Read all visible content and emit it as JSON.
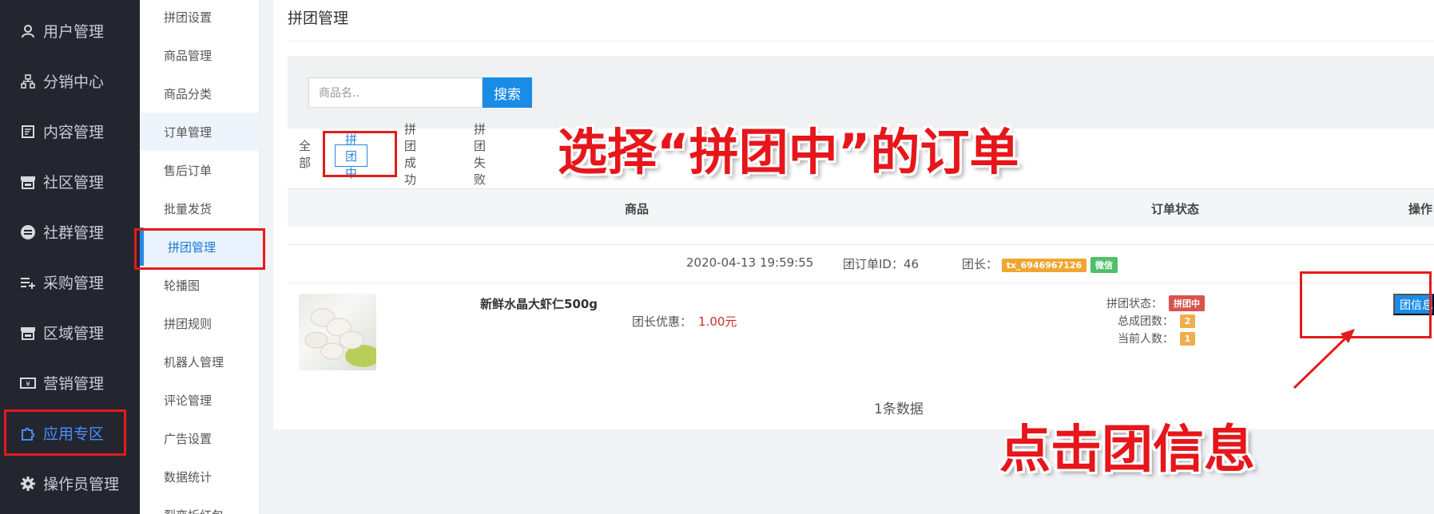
{
  "sidebar": {
    "items": [
      {
        "label": "用户管理",
        "icon": "user-icon"
      },
      {
        "label": "分销中心",
        "icon": "sitemap-icon"
      },
      {
        "label": "内容管理",
        "icon": "document-icon"
      },
      {
        "label": "社区管理",
        "icon": "store-icon"
      },
      {
        "label": "社群管理",
        "icon": "minus-circle-icon"
      },
      {
        "label": "采购管理",
        "icon": "list-add-icon"
      },
      {
        "label": "区域管理",
        "icon": "store-icon"
      },
      {
        "label": "营销管理",
        "icon": "ticket-icon"
      },
      {
        "label": "应用专区",
        "icon": "puzzle-icon",
        "active": true
      },
      {
        "label": "操作员管理",
        "icon": "gear-icon"
      }
    ]
  },
  "subnav": {
    "items": [
      {
        "label": "拼团设置"
      },
      {
        "label": "商品管理"
      },
      {
        "label": "商品分类"
      },
      {
        "label": "订单管理"
      },
      {
        "label": "售后订单"
      },
      {
        "label": "批量发货"
      },
      {
        "label": "拼团管理",
        "active": true
      },
      {
        "label": "轮播图"
      },
      {
        "label": "拼团规则"
      },
      {
        "label": "机器人管理"
      },
      {
        "label": "评论管理"
      },
      {
        "label": "广告设置"
      },
      {
        "label": "数据统计"
      },
      {
        "label": "裂变拆红包"
      }
    ]
  },
  "page": {
    "title": "拼团管理"
  },
  "search": {
    "placeholder": "商品名..",
    "button": "搜索"
  },
  "tabs": [
    {
      "label": "全部"
    },
    {
      "label": "拼团中",
      "active": true
    },
    {
      "label": "拼团成功"
    },
    {
      "label": "拼团失败"
    }
  ],
  "table": {
    "headers": {
      "product": "商品",
      "status": "订单状态",
      "action": "操作"
    }
  },
  "order": {
    "time": "2020-04-13 19:59:55",
    "group_id_label": "团订单ID：",
    "group_id": "46",
    "leader_label": "团长：",
    "leader_name": "tx_6946967126",
    "leader_channel": "微信",
    "product_name": "新鲜水晶大虾仁500g",
    "discount_label": "团长优惠：",
    "discount_value": "1.00元",
    "group_status_label": "拼团状态：",
    "group_status": "拼团中",
    "total_groups_label": "总成团数：",
    "total_groups": "2",
    "current_count_label": "当前人数：",
    "current_count": "1",
    "info_button": "团信息"
  },
  "footer": {
    "count_text": "1条数据"
  },
  "annotations": {
    "select_text": "选择“拼团中”的订单",
    "click_text": "点击团信息"
  },
  "colors": {
    "sidebar_bg": "#23262e",
    "accent": "#1a8ce6",
    "annotation_red": "#e31b1b",
    "tag_orange": "#f0a630",
    "tag_green": "#4fbf6b"
  }
}
